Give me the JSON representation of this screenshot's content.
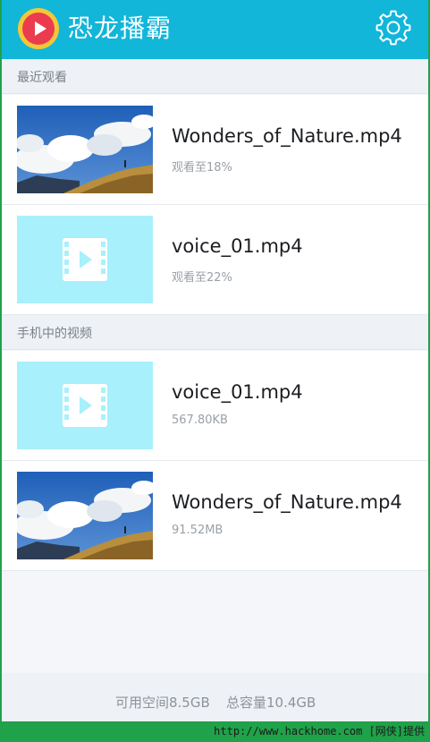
{
  "app": {
    "title": "恐龙播霸"
  },
  "sections": [
    {
      "header": "最近观看",
      "items": [
        {
          "name": "Wonders_of_Nature.mp4",
          "meta": "观看至18%",
          "thumb": "scenic"
        },
        {
          "name": "voice_01.mp4",
          "meta": "观看至22%",
          "thumb": "placeholder"
        }
      ]
    },
    {
      "header": "手机中的视频",
      "items": [
        {
          "name": "voice_01.mp4",
          "meta": "567.80KB",
          "thumb": "placeholder"
        },
        {
          "name": "Wonders_of_Nature.mp4",
          "meta": "91.52MB",
          "thumb": "scenic"
        }
      ]
    }
  ],
  "footer": {
    "available": "可用空间8.5GB",
    "total": "总容量10.4GB"
  },
  "credit": "http://www.hackhome.com [网侠]提供",
  "icons": {
    "logo": "play-logo-icon",
    "settings": "gear-icon",
    "video_placeholder": "film-play-icon"
  },
  "colors": {
    "appbar": "#11b6d9",
    "placeholder": "#a8f0fb",
    "frame": "#1fa24a"
  }
}
